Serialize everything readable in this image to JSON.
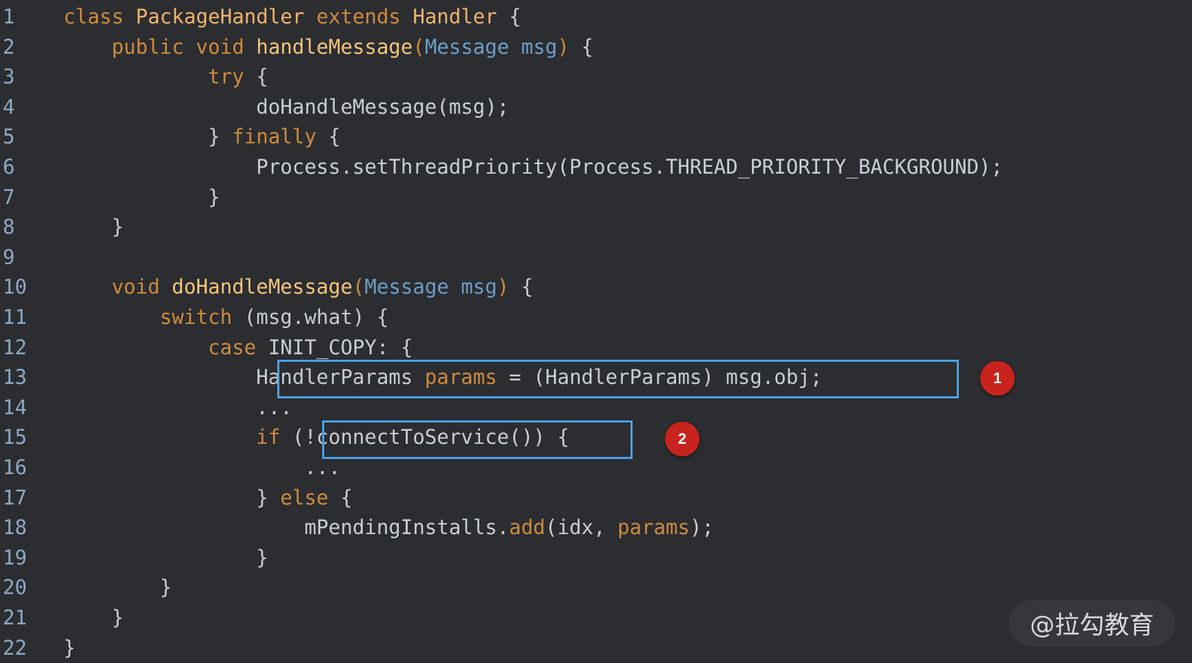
{
  "editor": {
    "theme_colors": {
      "background": "#2b2d31",
      "keyword": "#d08a3c",
      "type_name": "#f0b36b",
      "param": "#6d9ec9",
      "plain": "#c9cdd4",
      "highlight_box": "#4aa3e8",
      "badge": "#c8231c"
    },
    "lines": [
      {
        "n": "1",
        "segs": [
          [
            "kw",
            "class "
          ],
          [
            "ty",
            "PackageHandler "
          ],
          [
            "kw",
            "extends "
          ],
          [
            "ty",
            "Handler "
          ],
          [
            "pl",
            "{"
          ]
        ]
      },
      {
        "n": "2",
        "segs": [
          [
            "pl",
            "    "
          ],
          [
            "kw",
            "public void "
          ],
          [
            "fn",
            "handleMessage"
          ],
          [
            "kw",
            "("
          ],
          [
            "pm",
            "Message msg"
          ],
          [
            "kw",
            ")"
          ],
          [
            "pl",
            " {"
          ]
        ]
      },
      {
        "n": "3",
        "segs": [
          [
            "pl",
            "            "
          ],
          [
            "kw",
            "try"
          ],
          [
            "pl",
            " {"
          ]
        ]
      },
      {
        "n": "4",
        "segs": [
          [
            "pl",
            "                doHandleMessage(msg);"
          ]
        ]
      },
      {
        "n": "5",
        "segs": [
          [
            "pl",
            "            } "
          ],
          [
            "kw",
            "finally"
          ],
          [
            "pl",
            " {"
          ]
        ]
      },
      {
        "n": "6",
        "segs": [
          [
            "pl",
            "                Process.setThreadPriority(Process.THREAD_PRIORITY_BACKGROUND);"
          ]
        ]
      },
      {
        "n": "7",
        "segs": [
          [
            "pl",
            "            }"
          ]
        ]
      },
      {
        "n": "8",
        "segs": [
          [
            "pl",
            "    }"
          ]
        ]
      },
      {
        "n": "9",
        "segs": [
          [
            "pl",
            ""
          ]
        ]
      },
      {
        "n": "10",
        "segs": [
          [
            "pl",
            "    "
          ],
          [
            "kw",
            "void "
          ],
          [
            "fn",
            "doHandleMessage"
          ],
          [
            "kw",
            "("
          ],
          [
            "pm",
            "Message msg"
          ],
          [
            "kw",
            ")"
          ],
          [
            "pl",
            " {"
          ]
        ]
      },
      {
        "n": "11",
        "segs": [
          [
            "pl",
            "        "
          ],
          [
            "kw",
            "switch"
          ],
          [
            "pl",
            " (msg.what) {"
          ]
        ]
      },
      {
        "n": "12",
        "segs": [
          [
            "pl",
            "            "
          ],
          [
            "kw",
            "case"
          ],
          [
            "pl",
            " INIT_COPY: {"
          ]
        ]
      },
      {
        "n": "13",
        "segs": [
          [
            "pl",
            "                HandlerParams "
          ],
          [
            "kw",
            "params"
          ],
          [
            "pl",
            " = (HandlerParams) msg.obj;"
          ]
        ]
      },
      {
        "n": "14",
        "segs": [
          [
            "pl",
            "                ..."
          ]
        ]
      },
      {
        "n": "15",
        "segs": [
          [
            "pl",
            "                "
          ],
          [
            "kw",
            "if"
          ],
          [
            "pl",
            " (!connectToService()) {"
          ]
        ]
      },
      {
        "n": "16",
        "segs": [
          [
            "pl",
            "                    ..."
          ]
        ]
      },
      {
        "n": "17",
        "segs": [
          [
            "pl",
            "                } "
          ],
          [
            "kw",
            "else"
          ],
          [
            "pl",
            " {"
          ]
        ]
      },
      {
        "n": "18",
        "segs": [
          [
            "pl",
            "                    mPendingInstalls."
          ],
          [
            "kw",
            "add"
          ],
          [
            "pl",
            "(idx, "
          ],
          [
            "kw",
            "params"
          ],
          [
            "pl",
            ");"
          ]
        ]
      },
      {
        "n": "19",
        "segs": [
          [
            "pl",
            "                }"
          ]
        ]
      },
      {
        "n": "20",
        "segs": [
          [
            "pl",
            "        }"
          ]
        ]
      },
      {
        "n": "21",
        "segs": [
          [
            "pl",
            "    }"
          ]
        ]
      },
      {
        "n": "22",
        "segs": [
          [
            "pl",
            "}"
          ]
        ]
      }
    ]
  },
  "annotations": {
    "badge_1": "1",
    "badge_2": "2"
  },
  "watermark": "@拉勾教育"
}
